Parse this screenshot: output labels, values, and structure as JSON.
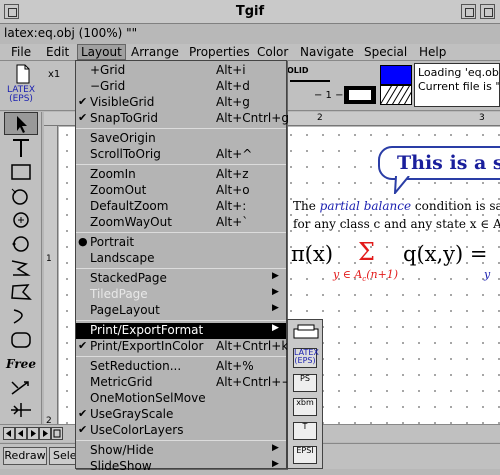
{
  "window": {
    "title": "Tgif"
  },
  "file_line": "latex:eq.obj (100%) \"\"",
  "menubar": [
    "File",
    "Edit",
    "Layout",
    "Arrange",
    "Properties",
    "Color",
    "Navigate",
    "Special",
    "Help"
  ],
  "toolbar": {
    "zoom_label": "x1",
    "latex_label_1": "LATEX",
    "latex_label_2": "(EPS)",
    "solid_label": "OLID",
    "line_style": "− 1 −",
    "blue_swatch_color": "#0000ff"
  },
  "message": {
    "line1": "Loading 'eq.ob",
    "line2": "Current file is \""
  },
  "rulers": {
    "top": [
      "2",
      "3"
    ],
    "left": [
      "1",
      "2"
    ]
  },
  "document": {
    "callout": "This is a sin",
    "line1_pre": "The ",
    "line1_em": "partial balance",
    "line1_post": " condition is satis",
    "line2": "for any class c and any state x ∈ A",
    "line2_sub": "c",
    "line2_tail": "(n",
    "formula_left": "π(x)",
    "formula_sigma": "Σ",
    "formula_right": "q(x,y) =",
    "formula_sub": "y ∈ A",
    "formula_sub_c": "c",
    "formula_sub_tail": "(n+1)",
    "formula_sub2": "y"
  },
  "layout_menu": {
    "items": [
      {
        "label": "+Grid",
        "accel": "Alt+i",
        "check": ""
      },
      {
        "label": "−Grid",
        "accel": "Alt+d",
        "check": ""
      },
      {
        "label": "VisibleGrid",
        "accel": "Alt+g",
        "check": "✔"
      },
      {
        "label": "SnapToGrid",
        "accel": "Alt+Cntrl+g",
        "check": "✔"
      },
      {
        "label": "SaveOrigin",
        "accel": "",
        "check": ""
      },
      {
        "label": "ScrollToOrig",
        "accel": "Alt+^",
        "check": ""
      },
      {
        "label": "ZoomIn",
        "accel": "Alt+z",
        "check": ""
      },
      {
        "label": "ZoomOut",
        "accel": "Alt+o",
        "check": ""
      },
      {
        "label": "DefaultZoom",
        "accel": "Alt+:",
        "check": ""
      },
      {
        "label": "ZoomWayOut",
        "accel": "Alt+`",
        "check": ""
      },
      {
        "label": "Portrait",
        "accel": "",
        "check": "●"
      },
      {
        "label": "Landscape",
        "accel": "",
        "check": ""
      },
      {
        "label": "StackedPage",
        "accel": "",
        "check": "",
        "arrow": "▶"
      },
      {
        "label": "TiledPage",
        "accel": "",
        "check": "",
        "arrow": "▶"
      },
      {
        "label": "PageLayout",
        "accel": "",
        "check": "",
        "arrow": "▶"
      },
      {
        "label": "Print/ExportFormat",
        "accel": "",
        "check": "",
        "arrow": "▶"
      },
      {
        "label": "Print/ExportInColor",
        "accel": "Alt+Cntrl+k",
        "check": "✔"
      },
      {
        "label": "SetReduction...",
        "accel": "Alt+%",
        "check": ""
      },
      {
        "label": "MetricGrid",
        "accel": "Alt+Cntrl+−",
        "check": ""
      },
      {
        "label": "OneMotionSelMove",
        "accel": "",
        "check": ""
      },
      {
        "label": "UseGrayScale",
        "accel": "",
        "check": "✔"
      },
      {
        "label": "UseColorLayers",
        "accel": "",
        "check": "✔"
      },
      {
        "label": "Show/Hide",
        "accel": "",
        "check": "",
        "arrow": "▶"
      },
      {
        "label": "SlideShow",
        "accel": "",
        "check": "",
        "arrow": "▶"
      }
    ]
  },
  "submenu": [
    "LATEX (EPS)",
    "PS",
    "xbm",
    "T",
    "EPSI"
  ],
  "status": {
    "redraw": "Redraw",
    "select": "Sele"
  }
}
